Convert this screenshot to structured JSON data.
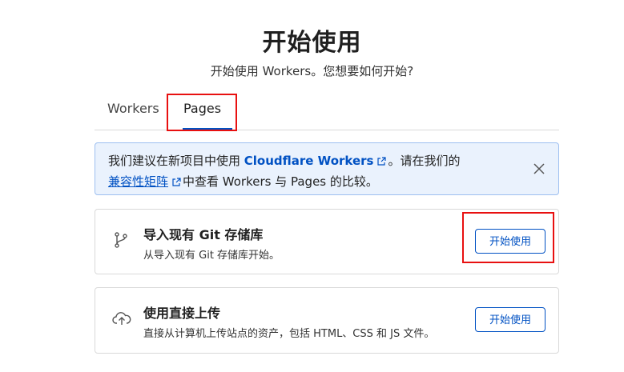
{
  "page": {
    "title": "开始使用",
    "subtitle": "开始使用 Workers。您想要如何开始?"
  },
  "tabs": [
    {
      "label": "Workers",
      "active": false
    },
    {
      "label": "Pages",
      "active": true
    }
  ],
  "banner": {
    "text_1": "我们建议在新项目中使用 ",
    "link_1": "Cloudflare Workers",
    "text_2": "。请在我们的",
    "link_2": "兼容性矩阵",
    "text_3": "中查看 Workers 与 Pages 的比较。",
    "close_icon": "close-icon",
    "external_icon": "external-link-icon"
  },
  "cards": [
    {
      "icon": "git-branch-icon",
      "title": "导入现有 Git 存储库",
      "description": "从导入现有 Git 存储库开始。",
      "button": "开始使用"
    },
    {
      "icon": "cloud-upload-icon",
      "title": "使用直接上传",
      "description": "直接从计算机上传站点的资产，包括 HTML、CSS 和 JS 文件。",
      "button": "开始使用"
    }
  ],
  "colors": {
    "accent": "#0051c3",
    "banner_bg": "#eaf2fd",
    "annotation": "#e81010"
  }
}
